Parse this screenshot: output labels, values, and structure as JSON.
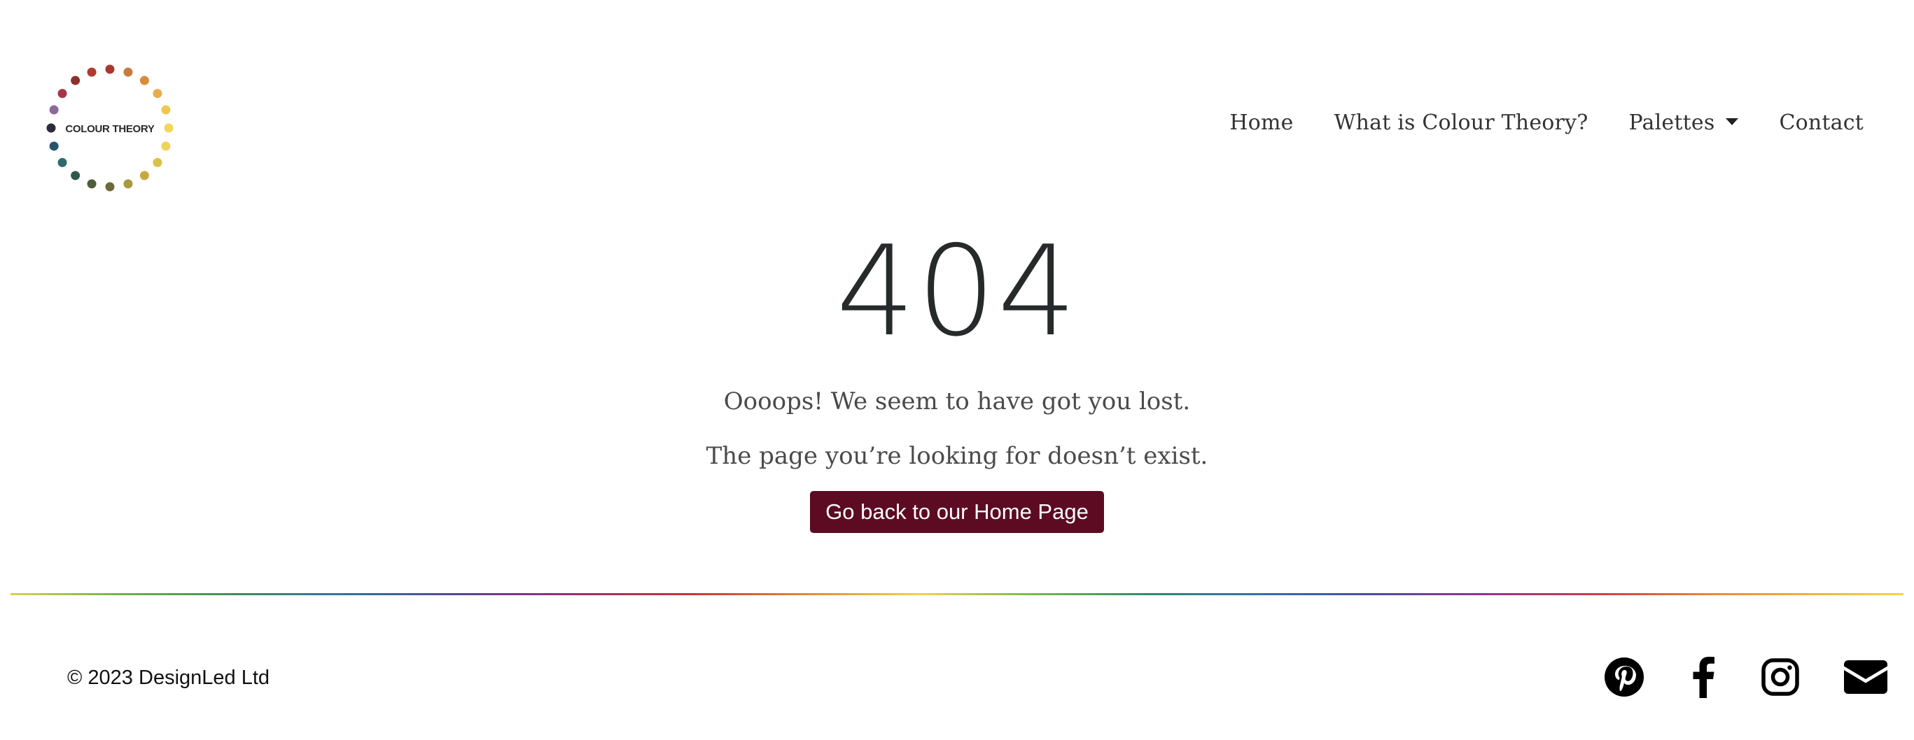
{
  "header": {
    "logo_text": "COLOUR THEORY",
    "nav": [
      {
        "label": "Home"
      },
      {
        "label": "What is Colour Theory?"
      },
      {
        "label": "Palettes",
        "has_dropdown": true
      },
      {
        "label": "Contact"
      }
    ]
  },
  "logo_dot_colors": [
    "#a8382f",
    "#c87b3c",
    "#d88b3a",
    "#e8ad4a",
    "#eec94e",
    "#f1d85c",
    "#eed35a",
    "#d8c24a",
    "#c9a83e",
    "#a89a3e",
    "#6d6a3a",
    "#4e5e3a",
    "#2f5a4a",
    "#2f6b6a",
    "#26546a",
    "#2a2c3a",
    "#8a6a9a",
    "#a8344a",
    "#8e2f2f",
    "#b03a30"
  ],
  "main": {
    "error_code": "404",
    "message_1": "Oooops! We seem to have got you lost.",
    "message_2": "The page you’re looking for doesn’t exist.",
    "home_button_label": "Go back to our Home Page"
  },
  "footer": {
    "copyright": "© 2023 DesignLed Ltd",
    "social": [
      {
        "icon": "pinterest-icon"
      },
      {
        "icon": "facebook-icon"
      },
      {
        "icon": "instagram-icon"
      },
      {
        "icon": "email-icon"
      }
    ]
  },
  "colors": {
    "button_bg": "#5c0b23",
    "button_text": "#ffffff",
    "heading": "#262a2a"
  }
}
